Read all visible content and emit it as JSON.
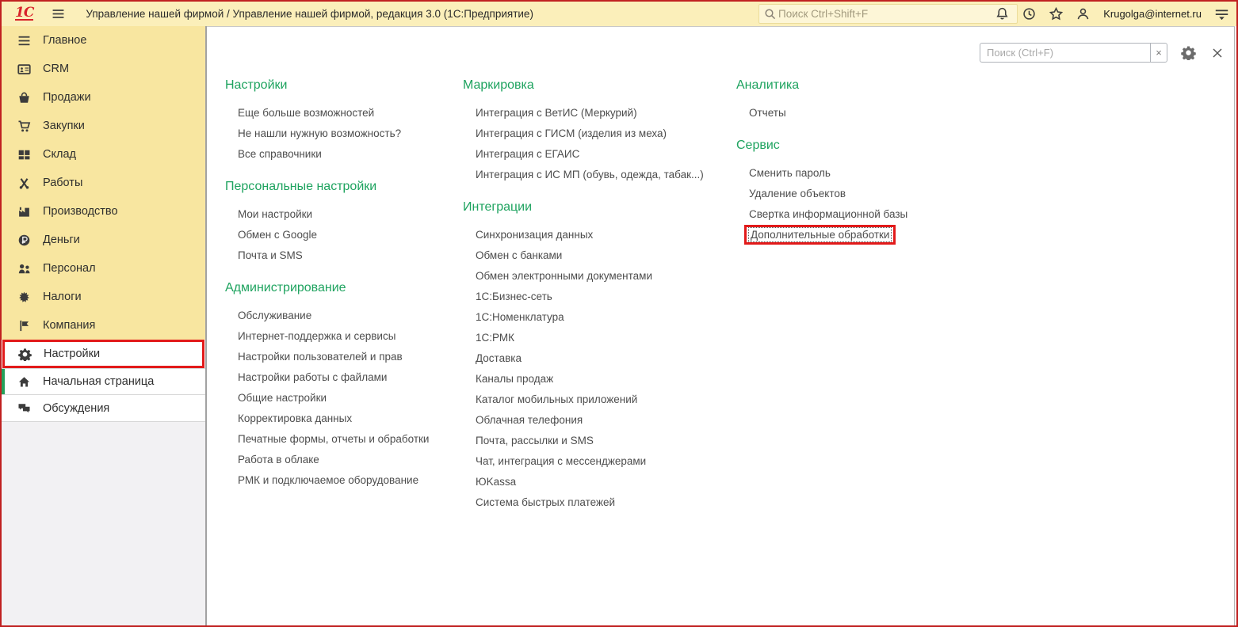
{
  "colors": {
    "topbar_bg": "#fbefba",
    "sidebar_bg": "#f8e6a0",
    "header_green": "#1ea35f",
    "annotation_red": "#e21a1a",
    "active_bar_green": "#24a05a"
  },
  "topbar": {
    "logo_text": "1С",
    "title": "Управление нашей фирмой / Управление нашей фирмой, редакция 3.0  (1С:Предприятие)",
    "search_placeholder": "Поиск Ctrl+Shift+F",
    "user_email": "Krugolga@internet.ru"
  },
  "sidebar": {
    "main_items": [
      {
        "label": "Главное",
        "icon": "menu-icon"
      },
      {
        "label": "CRM",
        "icon": "crm-icon"
      },
      {
        "label": "Продажи",
        "icon": "sales-basket-icon"
      },
      {
        "label": "Закупки",
        "icon": "purchases-cart-icon"
      },
      {
        "label": "Склад",
        "icon": "warehouse-icon"
      },
      {
        "label": "Работы",
        "icon": "works-tools-icon"
      },
      {
        "label": "Производство",
        "icon": "production-factory-icon"
      },
      {
        "label": "Деньги",
        "icon": "money-ruble-icon"
      },
      {
        "label": "Персонал",
        "icon": "personnel-icon"
      },
      {
        "label": "Налоги",
        "icon": "taxes-emblem-icon"
      },
      {
        "label": "Компания",
        "icon": "company-flag-icon"
      }
    ],
    "settings_item": {
      "label": "Настройки",
      "icon": "settings-gear-icon",
      "annotated": true
    },
    "bottom_items": [
      {
        "label": "Начальная страница",
        "icon": "home-icon",
        "active": true
      },
      {
        "label": "Обсуждения",
        "icon": "discussions-chat-icon",
        "active": false
      }
    ]
  },
  "panel": {
    "search_placeholder": "Поиск (Ctrl+F)",
    "clear_button": "×",
    "columns": [
      {
        "sections": [
          {
            "title": "Настройки",
            "items": [
              {
                "label": "Еще больше возможностей"
              },
              {
                "label": "Не нашли нужную возможность?"
              },
              {
                "label": "Все справочники"
              }
            ]
          },
          {
            "title": "Персональные настройки",
            "items": [
              {
                "label": "Мои настройки"
              },
              {
                "label": "Обмен с Google"
              },
              {
                "label": "Почта и SMS"
              }
            ]
          },
          {
            "title": "Администрирование",
            "items": [
              {
                "label": "Обслуживание"
              },
              {
                "label": "Интернет-поддержка и сервисы"
              },
              {
                "label": "Настройки пользователей и прав"
              },
              {
                "label": "Настройки работы с файлами"
              },
              {
                "label": "Общие настройки"
              },
              {
                "label": "Корректировка данных"
              },
              {
                "label": "Печатные формы, отчеты и обработки"
              },
              {
                "label": "Работа в облаке"
              },
              {
                "label": "РМК и подключаемое оборудование"
              }
            ]
          }
        ]
      },
      {
        "sections": [
          {
            "title": "Маркировка",
            "items": [
              {
                "label": "Интеграция с ВетИС (Меркурий)"
              },
              {
                "label": "Интеграция с ГИСМ (изделия из меха)"
              },
              {
                "label": "Интеграция с ЕГАИС"
              },
              {
                "label": "Интеграция с ИС МП (обувь, одежда, табак...)"
              }
            ]
          },
          {
            "title": "Интеграции",
            "items": [
              {
                "label": "Синхронизация данных"
              },
              {
                "label": "Обмен с банками"
              },
              {
                "label": "Обмен электронными документами"
              },
              {
                "label": "1С:Бизнес-сеть"
              },
              {
                "label": "1С:Номенклатура"
              },
              {
                "label": "1С:РМК"
              },
              {
                "label": "Доставка"
              },
              {
                "label": "Каналы продаж"
              },
              {
                "label": "Каталог мобильных приложений"
              },
              {
                "label": "Облачная телефония"
              },
              {
                "label": "Почта, рассылки и SMS"
              },
              {
                "label": "Чат, интеграция с мессенджерами"
              },
              {
                "label": "ЮKassa"
              },
              {
                "label": "Система быстрых платежей"
              }
            ]
          }
        ]
      },
      {
        "sections": [
          {
            "title": "Аналитика",
            "items": [
              {
                "label": "Отчеты"
              }
            ]
          },
          {
            "title": "Сервис",
            "items": [
              {
                "label": "Сменить пароль"
              },
              {
                "label": "Удаление объектов"
              },
              {
                "label": "Свертка информационной базы"
              },
              {
                "label": "Дополнительные обработки",
                "annotated": true
              }
            ]
          }
        ]
      }
    ]
  }
}
